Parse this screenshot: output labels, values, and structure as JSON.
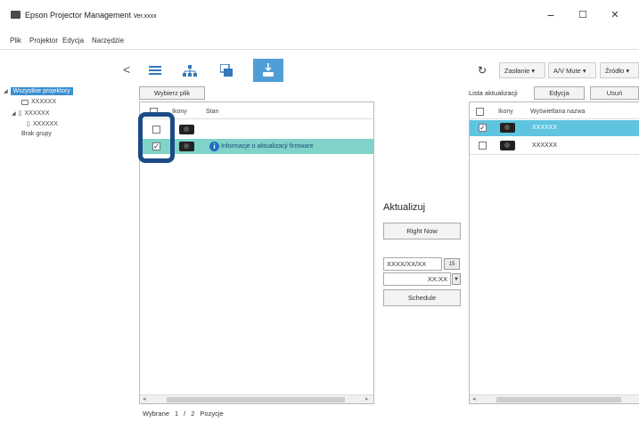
{
  "app": {
    "title": "Epson Projector Management",
    "version": "Ver.xxxx"
  },
  "window_controls": {
    "minimize": "−",
    "maximize": "☐",
    "close": "✕"
  },
  "menu": [
    "Plik",
    "Projektor",
    "Edycja",
    "Narzędzie"
  ],
  "toolbar": {
    "collapse": "<",
    "tabs": [
      {
        "icon": "list-view-icon"
      },
      {
        "icon": "group-view-icon"
      },
      {
        "icon": "layout-view-icon"
      },
      {
        "icon": "firmware-update-icon",
        "active": true
      }
    ],
    "right": {
      "refresh_icon": "refresh-icon",
      "shutter": "Zasłanie ▾",
      "av_mute": "A/V Mute ▾",
      "source": "Źródło ▾"
    }
  },
  "tree": {
    "root": "Wszystkie projektory",
    "items": [
      "XXXXXX",
      "XXXXXX",
      "XXXXXX"
    ],
    "no_group": "Brak grupy"
  },
  "left_panel": {
    "select_file": "Wybierz plik",
    "columns": {
      "icons": "Ikony",
      "status": "Stan"
    },
    "rows": [
      {
        "checked": false,
        "status": ""
      },
      {
        "checked": true,
        "status": "Informacje o aktualizacji firmware"
      }
    ]
  },
  "update_panel": {
    "title": "Aktualizuj",
    "right_now": "Right Now",
    "date": "XXXX/XX/XX",
    "date_btn": "15",
    "time": "XX:XX",
    "schedule": "Schedule"
  },
  "right_panel": {
    "title": "Lista aktualizacji",
    "edit": "Edycja",
    "delete": "Usuń",
    "columns": {
      "icons": "Ikony",
      "name": "Wyświetlana nazwa"
    },
    "rows": [
      {
        "checked": true,
        "name": "XXXXXX"
      },
      {
        "checked": false,
        "name": "XXXXXX"
      }
    ]
  },
  "status": {
    "selected_label": "Wybrane",
    "selected_count": "1",
    "separator": "/",
    "total": "2",
    "items_label": "Pozycje"
  },
  "colors": {
    "accent": "#4f9ed6",
    "row_highlight": "#7fd3c9",
    "focus_outline": "#1b4b86"
  }
}
